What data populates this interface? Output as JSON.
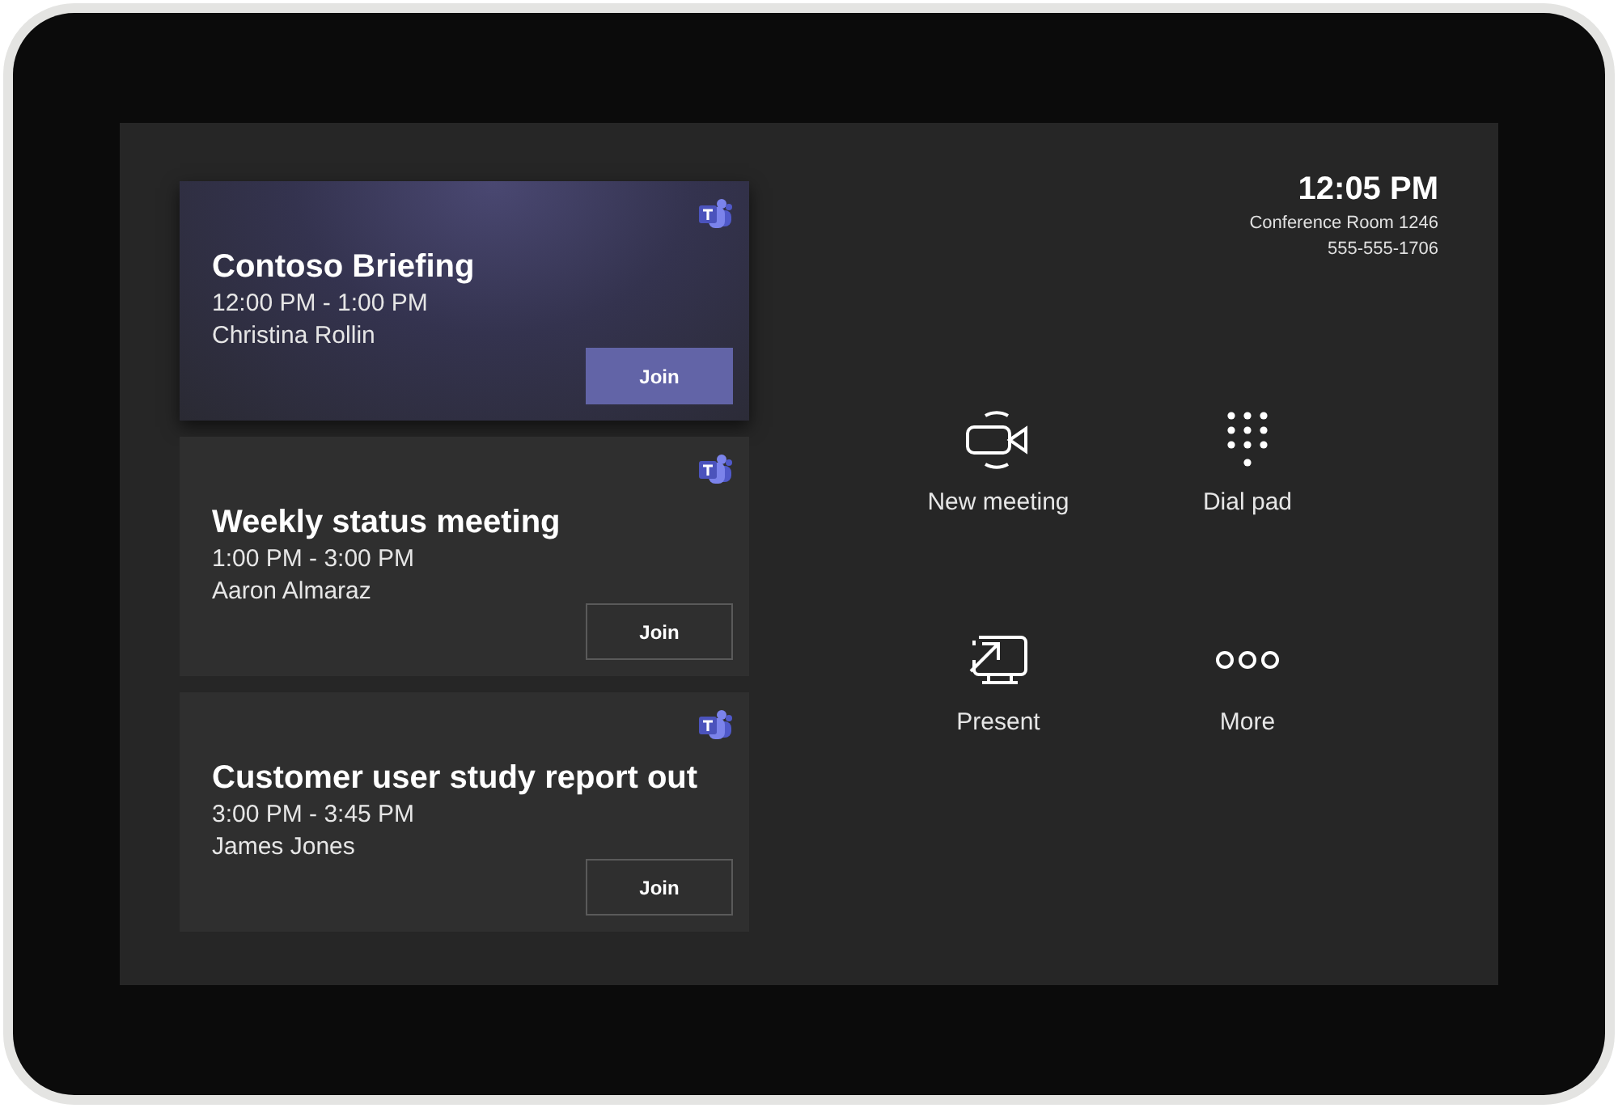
{
  "clock": {
    "time": "12:05 PM",
    "room": "Conference Room 1246",
    "phone": "555-555-1706"
  },
  "meetings": [
    {
      "title": "Contoso Briefing",
      "time": "12:00 PM - 1:00 PM",
      "organizer": "Christina Rollin",
      "join": "Join",
      "selected": true
    },
    {
      "title": "Weekly status meeting",
      "time": "1:00 PM - 3:00 PM",
      "organizer": "Aaron Almaraz",
      "join": "Join",
      "selected": false
    },
    {
      "title": "Customer user study report out",
      "time": "3:00 PM - 3:45 PM",
      "organizer": "James Jones",
      "join": "Join",
      "selected": false
    }
  ],
  "actions": [
    {
      "kind": "video",
      "label": "New meeting"
    },
    {
      "kind": "dialpad",
      "label": "Dial pad"
    },
    {
      "kind": "present",
      "label": "Present"
    },
    {
      "kind": "more",
      "label": "More"
    }
  ]
}
